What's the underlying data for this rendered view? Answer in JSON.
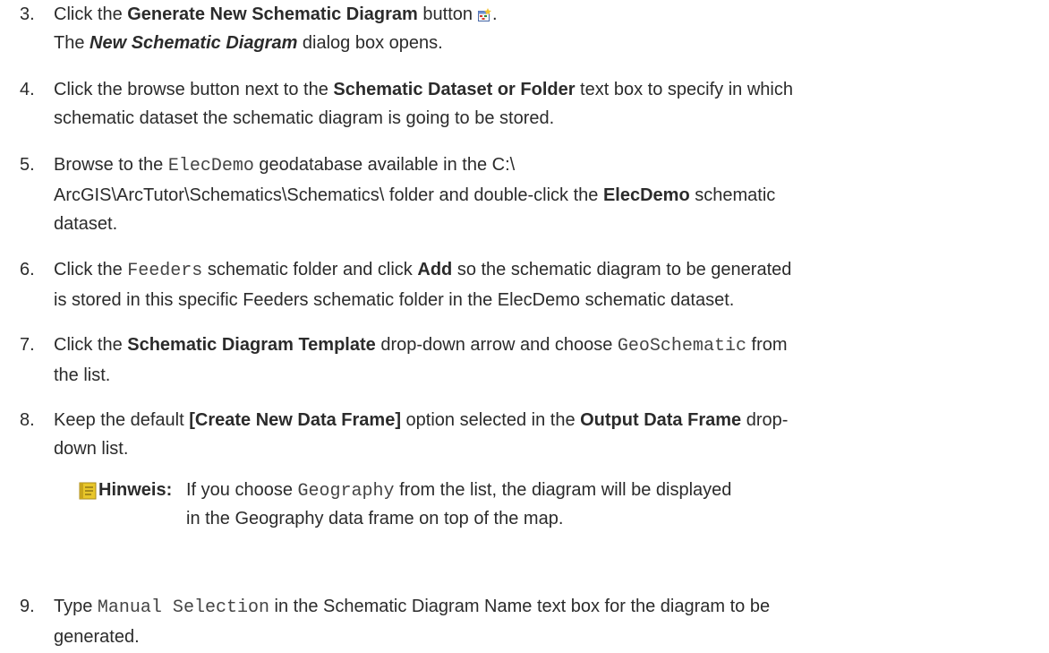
{
  "steps": [
    {
      "number": "3.",
      "t1": "Click the ",
      "b1": "Generate New Schematic Diagram",
      "t2": " button",
      "t3": ".",
      "t4": "The ",
      "bi1": "New Schematic Diagram",
      "t5": " dialog box opens."
    },
    {
      "number": "4.",
      "t1": "Click the browse button next to the ",
      "b1": "Schematic Dataset or Folder",
      "t2": " text box to specify in which",
      "t3": "schematic dataset the schematic diagram is going to be stored."
    },
    {
      "number": "5.",
      "t1": "Browse to the ",
      "m1": "ElecDemo",
      "t2": " geodatabase available in the C:\\",
      "t3": "ArcGIS\\ArcTutor\\Schematics\\Schematics\\ folder and double-click the ",
      "b1": "ElecDemo",
      "t4": " schematic",
      "t5": "dataset."
    },
    {
      "number": "6.",
      "t1": "Click the ",
      "m1": "Feeders",
      "t2": " schematic folder and click ",
      "b1": "Add",
      "t3": " so the schematic diagram to be generated",
      "t4": "is stored in this specific Feeders schematic folder in the ElecDemo schematic dataset."
    },
    {
      "number": "7.",
      "t1": "Click the ",
      "b1": "Schematic Diagram Template",
      "t2": " drop-down arrow and choose ",
      "m1": "GeoSchematic",
      "t3": " from",
      "t4": "the list."
    },
    {
      "number": "8.",
      "t1": "Keep the default ",
      "b1": "[Create New Data Frame]",
      "t2": " option selected in the ",
      "b2": "Output Data Frame",
      "t3": " drop-",
      "t4": "down list."
    },
    {
      "number": "9.",
      "t1": "Type ",
      "m1": "Manual Selection",
      "t2": " in the Schematic Diagram Name text box for the diagram to be",
      "t3": "generated."
    }
  ],
  "note": {
    "label": "Hinweis:",
    "t1": "If you choose ",
    "m1": "Geography",
    "t2": " from the list, the diagram will be displayed",
    "t3": "in the Geography data frame on top of the map.",
    "icon": "note-icon"
  },
  "colors": {
    "text": "#2b2b2b",
    "note_icon": "#e8c62a"
  }
}
